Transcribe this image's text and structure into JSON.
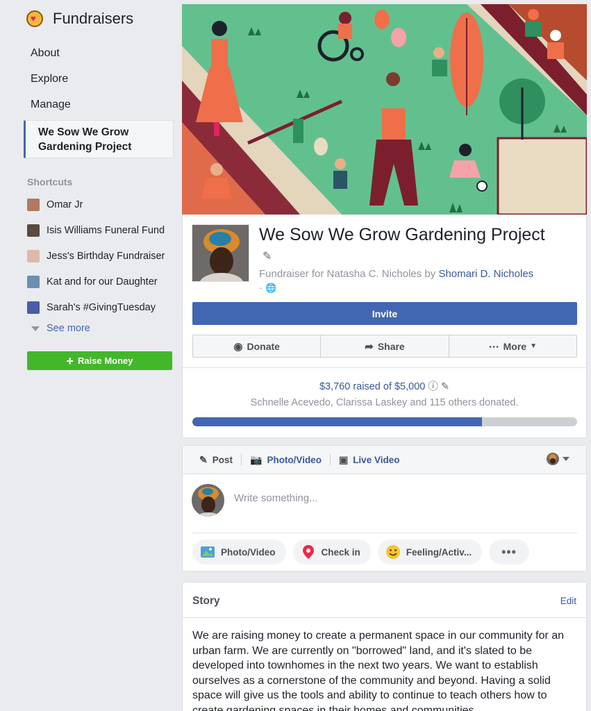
{
  "sidebar": {
    "title": "Fundraisers",
    "nav": [
      {
        "label": "About"
      },
      {
        "label": "Explore"
      },
      {
        "label": "Manage"
      },
      {
        "label": "We Sow We Grow Gardening Project"
      }
    ],
    "shortcuts_label": "Shortcuts",
    "shortcuts": [
      {
        "label": "Omar Jr",
        "color": "#b07a60"
      },
      {
        "label": "Isis Williams Funeral Fund",
        "color": "#5a4a3f"
      },
      {
        "label": "Jess's Birthday Fundraiser",
        "color": "#e0b8a8"
      },
      {
        "label": "Kat and for our Daughter",
        "color": "#6b8fb0"
      },
      {
        "label": "Sarah's #GivingTuesday",
        "color": "#4a5da8"
      }
    ],
    "see_more": "See more",
    "raise_money": "Raise Money"
  },
  "fundraiser": {
    "title": "We Sow We Grow Gardening Project",
    "subtitle_prefix": "Fundraiser for Natasha C. Nicholes by",
    "organizer": "Shomari D. Nicholes",
    "visibility_separator": "·",
    "invite": "Invite",
    "actions": {
      "donate": "Donate",
      "share": "Share",
      "more": "More"
    },
    "raised_text": "$3,760 raised of $5,000",
    "raised_amount": 3760,
    "goal_amount": 5000,
    "progress_fraction": 0.752,
    "donors": "Schnelle Acevedo, Clarissa Laskey and 115 others donated."
  },
  "composer": {
    "tabs": {
      "post": "Post",
      "photo_video": "Photo/Video",
      "live_video": "Live Video"
    },
    "placeholder": "Write something...",
    "chips": {
      "photo_video": "Photo/Video",
      "check_in": "Check in",
      "feeling": "Feeling/Activ..."
    }
  },
  "story": {
    "heading": "Story",
    "edit": "Edit",
    "body": "We are raising money to create a permanent space in our community for an urban farm. We are currently on \"borrowed\" land, and it's slated to be developed into townhomes in the next two years. We want to establish ourselves as a cornerstone of the community and beyond. Having a solid space will give us the tools and ability to continue to teach others how to create gardening spaces in their homes and communities."
  },
  "colors": {
    "brand_blue": "#4267b2",
    "link_blue": "#385898",
    "green_button": "#42b72a",
    "page_bg": "#e9ebee",
    "cover_green": "#62c08f"
  }
}
